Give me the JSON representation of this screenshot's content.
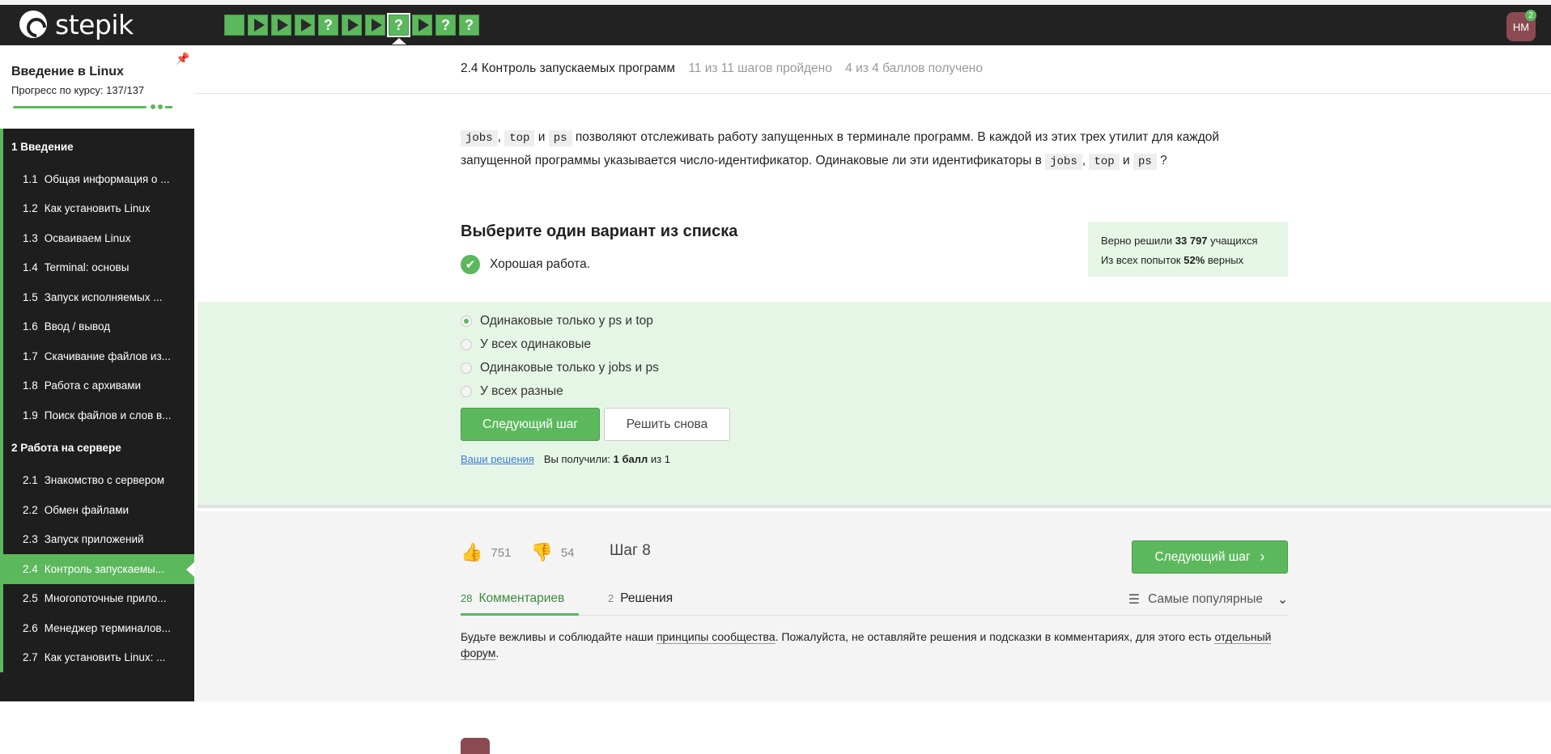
{
  "topbar": {
    "logo_text": "stepik",
    "steps": [
      {
        "type": "blank",
        "icon": "square-icon"
      },
      {
        "type": "video",
        "icon": "play-icon"
      },
      {
        "type": "video",
        "icon": "play-icon"
      },
      {
        "type": "video",
        "icon": "play-icon"
      },
      {
        "type": "quiz",
        "label": "?"
      },
      {
        "type": "video",
        "icon": "play-icon"
      },
      {
        "type": "video",
        "icon": "play-icon"
      },
      {
        "type": "quiz",
        "label": "?",
        "active": true
      },
      {
        "type": "video",
        "icon": "play-icon"
      },
      {
        "type": "quiz",
        "label": "?"
      },
      {
        "type": "quiz",
        "label": "?"
      }
    ],
    "user_initials": "НМ",
    "notifications": "2"
  },
  "sidebar": {
    "course_title": "Введение в Linux",
    "progress_text": "Прогресс по курсу:  137/137",
    "sections": [
      {
        "label": "1  Введение",
        "items": [
          {
            "num": "1.1",
            "label": "Общая информация о ..."
          },
          {
            "num": "1.2",
            "label": "Как установить Linux"
          },
          {
            "num": "1.3",
            "label": "Осваиваем Linux"
          },
          {
            "num": "1.4",
            "label": "Terminal: основы"
          },
          {
            "num": "1.5",
            "label": "Запуск исполняемых ..."
          },
          {
            "num": "1.6",
            "label": "Ввод / вывод"
          },
          {
            "num": "1.7",
            "label": "Скачивание файлов из..."
          },
          {
            "num": "1.8",
            "label": "Работа с архивами"
          },
          {
            "num": "1.9",
            "label": "Поиск файлов и слов в..."
          }
        ]
      },
      {
        "label": "2  Работа на сервере",
        "items": [
          {
            "num": "2.1",
            "label": "Знакомство с сервером"
          },
          {
            "num": "2.2",
            "label": "Обмен файлами"
          },
          {
            "num": "2.3",
            "label": "Запуск приложений"
          },
          {
            "num": "2.4",
            "label": "Контроль запускаемы...",
            "active": true
          },
          {
            "num": "2.5",
            "label": "Многопоточные прило..."
          },
          {
            "num": "2.6",
            "label": "Менеджер терминалов..."
          },
          {
            "num": "2.7",
            "label": "Как установить Linux: ..."
          }
        ]
      }
    ]
  },
  "lesson": {
    "title": "2.4 Контроль запускаемых программ",
    "steps_done": "11 из 11 шагов пройдено",
    "points": "4 из 4 баллов  получено"
  },
  "question": {
    "code_jobs": "jobs",
    "code_top": "top",
    "code_ps": "ps",
    "sep_comma": ",",
    "word_and": "и",
    "text_1": "позволяют отслеживать работу запущенных в терминале программ. В каждой из этих трех утилит для каждой запущенной программы указывается число-идентификатор. Одинаковые ли эти идентификаторы в",
    "qmark": "?"
  },
  "quiz": {
    "title": "Выберите один вариант из списка",
    "feedback": "Хорошая работа.",
    "stats_line1_a": "Верно решили ",
    "stats_line1_b": "33 797",
    "stats_line1_c": " учащихся",
    "stats_line2_a": "Из всех попыток ",
    "stats_line2_b": "52%",
    "stats_line2_c": " верных",
    "options": [
      {
        "label": "Одинаковые только у ps и top",
        "selected": true
      },
      {
        "label": "У всех одинаковые",
        "selected": false
      },
      {
        "label": "Одинаковые только у jobs и ps",
        "selected": false
      },
      {
        "label": "У всех разные",
        "selected": false
      }
    ],
    "next_button": "Следующий шаг",
    "retry_button": "Решить снова",
    "your_solutions": "Ваши решения",
    "score_prefix": "Вы получили: ",
    "score_bold": "1 балл",
    "score_suffix": " из 1"
  },
  "footer": {
    "likes": "751",
    "dislikes": "54",
    "step_label": "Шаг 8",
    "next_button": "Следующий шаг",
    "tabs": [
      {
        "count": "28",
        "label": "Комментариев",
        "active": true
      },
      {
        "count": "2",
        "label": "Решения",
        "active": false
      }
    ],
    "sort_label": "Самые популярные",
    "rules_a": "Будьте вежливы и соблюдайте наши ",
    "rules_link1": "принципы сообщества",
    "rules_b": ". Пожалуйста, не оставляйте решения и подсказки в комментариях, для этого есть ",
    "rules_link2": "отдельный форум",
    "rules_c": "."
  },
  "colors": {
    "accent": "#5cb85c",
    "topbar": "#222222",
    "sidebar": "#1e1e1e",
    "answer_bg": "#e6f6e6"
  }
}
